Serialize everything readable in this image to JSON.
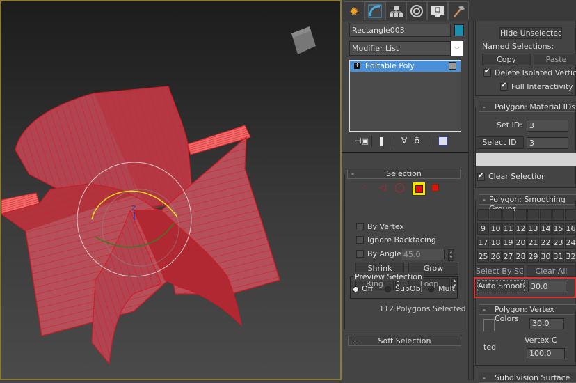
{
  "viewport": {
    "gizmo_axis_label": "Z",
    "viewcube_label": "viewcube"
  },
  "command_panel": {
    "tabs": [
      {
        "name": "create",
        "icon": "sun-icon",
        "active": false
      },
      {
        "name": "modify",
        "icon": "modify-arc-icon",
        "active": true
      },
      {
        "name": "hierarchy",
        "icon": "hierarchy-icon",
        "active": false
      },
      {
        "name": "motion",
        "icon": "motion-icon",
        "active": false
      },
      {
        "name": "display",
        "icon": "display-monitor-icon",
        "active": false
      },
      {
        "name": "utilities",
        "icon": "hammer-icon",
        "active": false
      }
    ],
    "object_name": "Rectangle003",
    "object_color": "#1a8fb0",
    "modifier_list_label": "Modifier List",
    "stack": [
      {
        "label": "Editable Poly",
        "selected": true,
        "expand": "+"
      }
    ],
    "stack_toolbar": [
      "pin-stack-icon",
      "show-end-result-icon",
      "make-unique-icon",
      "remove-modifier-icon",
      "configure-modifier-sets-icon"
    ],
    "selection": {
      "title": "Selection",
      "collapse_sign": "-",
      "subobject_levels": [
        "vertex",
        "edge",
        "border",
        "polygon",
        "element"
      ],
      "active_level": "polygon",
      "by_vertex": {
        "label": "By Vertex",
        "checked": false
      },
      "ignore_backfacing": {
        "label": "Ignore Backfacing",
        "checked": false
      },
      "by_angle": {
        "label": "By Angle:",
        "checked": false,
        "value": "45.0"
      },
      "shrink": "Shrink",
      "grow": "Grow",
      "ring": "Ring",
      "loop": "Loop",
      "preview": {
        "title": "Preview Selection",
        "options": [
          "Off",
          "SubObj",
          "Multi"
        ],
        "selected": "Off"
      },
      "status": "112 Polygons Selected"
    },
    "soft_selection": {
      "title": "Soft Selection",
      "collapse_sign": "+"
    },
    "right_column": {
      "hide_unselected": "Hide Unselected",
      "named_selections_label": "Named Selections:",
      "copy": "Copy",
      "paste": "Paste",
      "delete_isolated": {
        "label": "Delete Isolated Vertices",
        "checked": true
      },
      "full_interactivity": {
        "label": "Full Interactivity",
        "checked": true
      },
      "material_ids": {
        "title": "Polygon: Material IDs",
        "collapse_sign": "-",
        "set_id_label": "Set ID:",
        "set_id_value": "3",
        "select_id_label": "Select ID",
        "select_id_value": "3",
        "clear_selection": {
          "label": "Clear Selection",
          "checked": true
        }
      },
      "smoothing_groups": {
        "title": "Polygon: Smoothing Groups",
        "collapse_sign": "-",
        "row1": [
          "",
          "",
          "",
          "",
          "",
          "",
          "",
          ""
        ],
        "row2": [
          "9",
          "10",
          "11",
          "12",
          "13",
          "14",
          "15",
          "16"
        ],
        "row3": [
          "17",
          "18",
          "19",
          "20",
          "21",
          "22",
          "23",
          "24"
        ],
        "row4": [
          "25",
          "26",
          "27",
          "28",
          "29",
          "30",
          "31",
          "32"
        ],
        "select_by_sg": "Select By SG",
        "clear_all": "Clear All",
        "auto_smooth": "Auto Smooth",
        "auto_smooth_value": "30.0",
        "highlight_color": "#e03030"
      },
      "vertex_colors": {
        "title": "Polygon: Vertex Colors",
        "collapse_sign": "-",
        "value1": "30.0",
        "glitch_text1": "Vertex C",
        "glitch_text2": "ted",
        "value2": "100.0"
      },
      "subdivision_surface": {
        "title": "Subdivision Surface",
        "collapse_sign": "-"
      }
    }
  }
}
